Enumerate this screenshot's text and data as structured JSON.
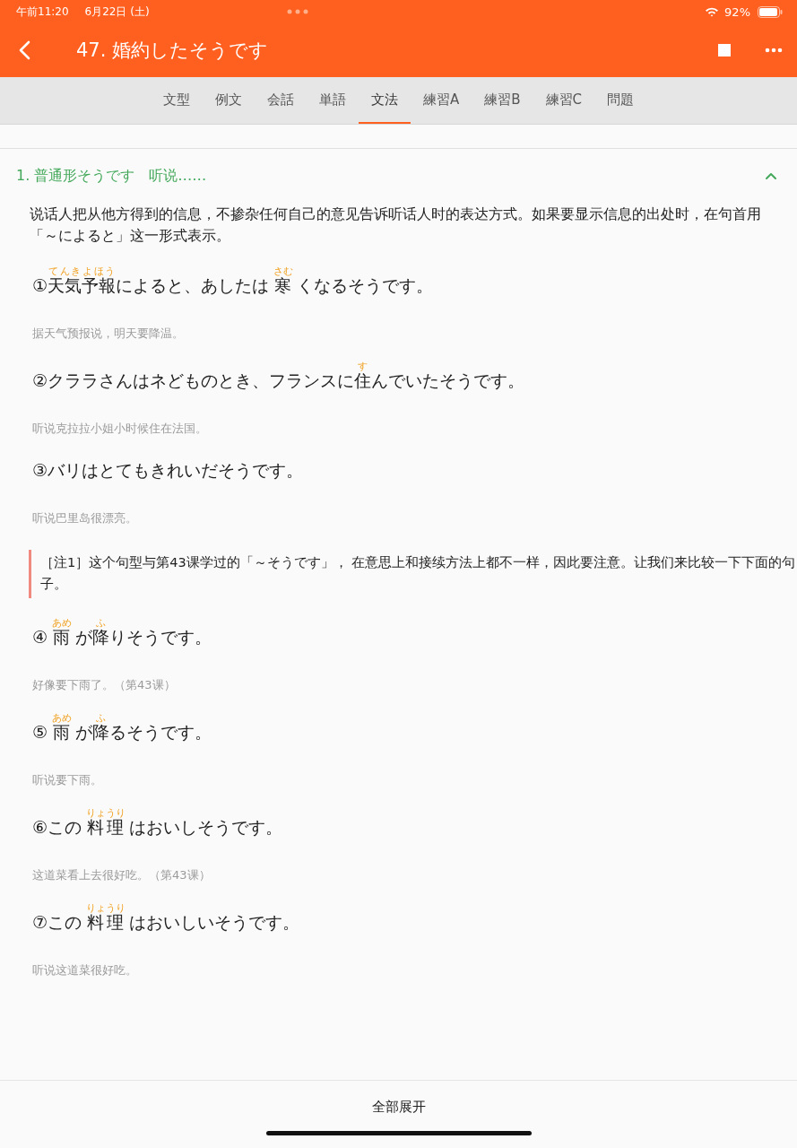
{
  "status_bar": {
    "time": "午前11:20",
    "date": "6月22日 (土)",
    "battery": "92%"
  },
  "header": {
    "title": "47. 婚約したそうです"
  },
  "tabs": [
    {
      "label": "文型",
      "selected": false
    },
    {
      "label": "例文",
      "selected": false
    },
    {
      "label": "会話",
      "selected": false
    },
    {
      "label": "単語",
      "selected": false
    },
    {
      "label": "文法",
      "selected": true
    },
    {
      "label": "練習A",
      "selected": false
    },
    {
      "label": "練習B",
      "selected": false
    },
    {
      "label": "練習C",
      "selected": false
    },
    {
      "label": "問題",
      "selected": false
    }
  ],
  "section": {
    "title": "1. 普通形そうです　听说……",
    "expanded": true,
    "intro": "说话人把从他方得到的信息，不掺杂任何自己的意见告诉听话人时的表达方式。如果要显示信息的出处时，在句首用「～によると」这一形式表示。",
    "items": [
      {
        "kind": "example",
        "segments": [
          {
            "text": "①"
          },
          {
            "text": "天気予報",
            "ruby": "てんきよほう"
          },
          {
            "text": "によると、あしたは "
          },
          {
            "text": "寒",
            "ruby": "さむ"
          },
          {
            "text": " くなるそうです。"
          }
        ],
        "translation": "据天气预报说，明天要降温。"
      },
      {
        "kind": "example",
        "segments": [
          {
            "text": "②クララさんはネどものとき、フランスに"
          },
          {
            "text": "住",
            "ruby": "す"
          },
          {
            "text": "んでいたそうです。"
          }
        ],
        "translation": "听说克拉拉小姐小时候住在法国。"
      },
      {
        "kind": "example",
        "segments": [
          {
            "text": "③バリはとてもきれいだそうです。"
          }
        ],
        "translation": "听说巴里岛很漂亮。"
      },
      {
        "kind": "note",
        "text": "［注1］这个句型与第43课学过的「～そうです」， 在意思上和接续方法上都不一样，因此要注意。让我们来比较一下下面的句子。"
      },
      {
        "kind": "example",
        "segments": [
          {
            "text": "④ "
          },
          {
            "text": "雨",
            "ruby": "あめ"
          },
          {
            "text": " が"
          },
          {
            "text": "降",
            "ruby": "ふ"
          },
          {
            "text": "りそうです。"
          }
        ],
        "translation": "好像要下雨了。（第43课）"
      },
      {
        "kind": "example",
        "segments": [
          {
            "text": "⑤ "
          },
          {
            "text": "雨",
            "ruby": "あめ"
          },
          {
            "text": " が"
          },
          {
            "text": "降",
            "ruby": "ふ"
          },
          {
            "text": "るそうです。"
          }
        ],
        "translation": "听说要下雨。"
      },
      {
        "kind": "example",
        "segments": [
          {
            "text": "⑥この "
          },
          {
            "text": "料理",
            "ruby": "りょうり"
          },
          {
            "text": " はおいしそうです。"
          }
        ],
        "translation": "这道菜看上去很好吃。（第43课）"
      },
      {
        "kind": "example",
        "segments": [
          {
            "text": "⑦この "
          },
          {
            "text": "料理",
            "ruby": "りょうり"
          },
          {
            "text": " はおいしいそうです。"
          }
        ],
        "translation": "听说这道菜很好吃。"
      }
    ]
  },
  "footer": {
    "button": "全部展开"
  }
}
